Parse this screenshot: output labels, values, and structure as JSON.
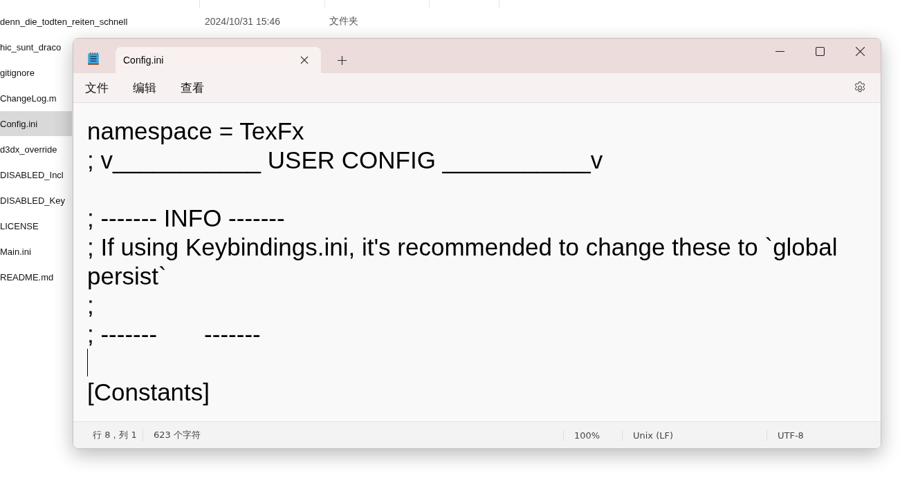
{
  "explorer": {
    "rows": [
      {
        "name": "denn_die_todten_reiten_schnell",
        "date": "2024/10/31 15:46",
        "type": "文件夹",
        "selected": false
      },
      {
        "name": "hic_sunt_draco",
        "selected": false
      },
      {
        "name": "gitignore",
        "selected": false
      },
      {
        "name": "ChangeLog.m",
        "selected": false
      },
      {
        "name": "Config.ini",
        "selected": true
      },
      {
        "name": "d3dx_override",
        "selected": false
      },
      {
        "name": "DISABLED_Incl",
        "selected": false
      },
      {
        "name": "DISABLED_Key",
        "selected": false
      },
      {
        "name": "LICENSE",
        "selected": false
      },
      {
        "name": "Main.ini",
        "selected": false
      },
      {
        "name": "README.md",
        "selected": false
      }
    ]
  },
  "notepad": {
    "tabs": [
      {
        "label": "Config.ini",
        "selected": true
      }
    ],
    "menu": [
      "文件",
      "编辑",
      "查看"
    ],
    "lines": [
      {
        "text": "namespace = TexFx",
        "caret": false
      },
      {
        "text": "; v___________ USER CONFIG ___________v",
        "caret": false
      },
      {
        "caret": false
      },
      {
        "text": "; ------- INFO -------",
        "caret": false
      },
      {
        "text": "; If using Keybindings.ini, it's recommended to change these to `global persist`",
        "caret": false
      },
      {
        "text": ";",
        "caret": false
      },
      {
        "text": "; -------       -------",
        "caret": false
      },
      {
        "caret": true
      },
      {
        "text": "[Constants]",
        "caret": false
      }
    ],
    "status_bar": {
      "position": "行 8，列 1",
      "characters": "623 个字符",
      "zoom": "100%",
      "line_ending": "Unix (LF)",
      "encoding": "UTF-8"
    }
  }
}
